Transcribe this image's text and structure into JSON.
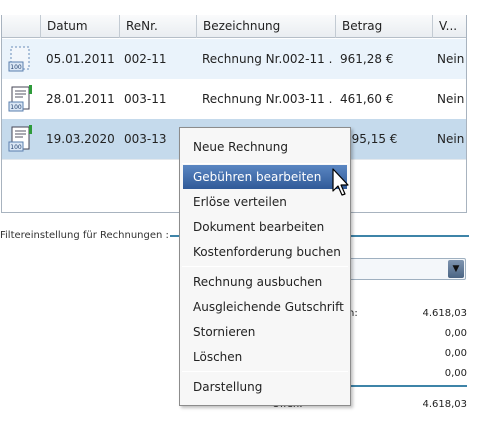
{
  "table": {
    "columns": [
      "Datum",
      "ReNr.",
      "Bezeichnung",
      "Betrag",
      "V..."
    ],
    "rows": [
      {
        "icon": "invoice-draft-icon",
        "datum": "05.01.2011",
        "renr": "002-11",
        "bezeichnung": "Rechnung Nr.002-11 ...",
        "betrag": "961,28 €",
        "v": "Nein"
      },
      {
        "icon": "invoice-document-icon",
        "datum": "28.01.2011",
        "renr": "003-11",
        "bezeichnung": "Rechnung Nr.003-11 ...",
        "betrag": "461,60 €",
        "v": "Nein"
      },
      {
        "icon": "invoice-document-icon",
        "datum": "19.03.2020",
        "renr": "003-13",
        "bezeichnung": "",
        "betrag": "195,15 €",
        "v": "Nein"
      }
    ]
  },
  "filter": {
    "label": "Filtereinstellung für Rechnungen :"
  },
  "summary": {
    "row1_label": "n:",
    "row1_value": "4.618,03",
    "row2_value": "0,00",
    "row3_value": "0,00",
    "row4_value": "0,00",
    "total_label": "Offen:",
    "total_value": "4.618,03"
  },
  "context_menu": {
    "items": [
      "Neue Rechnung",
      "Gebühren bearbeiten",
      "Erlöse verteilen",
      "Dokument bearbeiten",
      "Kostenforderung buchen",
      "Rechnung ausbuchen",
      "Ausgleichende Gutschrift",
      "Stornieren",
      "Löschen",
      "Darstellung"
    ],
    "active_index": 1
  },
  "colors": {
    "selected_row": "#c5daec",
    "menu_highlight": "#305a98",
    "accent_line": "#3e84a8"
  }
}
